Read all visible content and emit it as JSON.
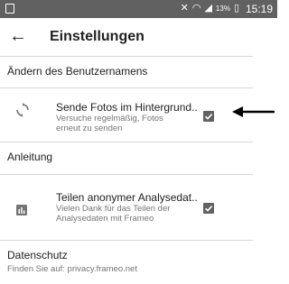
{
  "status_bar": {
    "icons": [
      "gallery-icon",
      "mute-icon",
      "wifi-icon",
      "signal-icon"
    ],
    "battery_percent": "13%",
    "time": "15:19"
  },
  "app_bar": {
    "back_icon": "arrow-back-icon",
    "title": "Einstellungen"
  },
  "settings": {
    "change_username": "Ändern des Benutzernamens",
    "send_photos": {
      "title": "Sende Fotos im Hintergrund..",
      "summary": "Versuche regelmäßig, Fotos erneut zu senden",
      "icon": "sync-icon",
      "checked": true
    },
    "tutorial": "Anleitung",
    "analytics": {
      "title": "Teilen anonymer Analysedat..",
      "summary": "Vielen Dank für das Teilen der Analysedaten mit Frameo",
      "icon": "analytics-icon",
      "checked": true
    },
    "privacy": {
      "title": "Datenschutz",
      "summary": "Finden Sie auf: privacy.frameo.net"
    }
  },
  "annotation": {
    "icon": "arrow-left-icon",
    "color": "#000000"
  }
}
